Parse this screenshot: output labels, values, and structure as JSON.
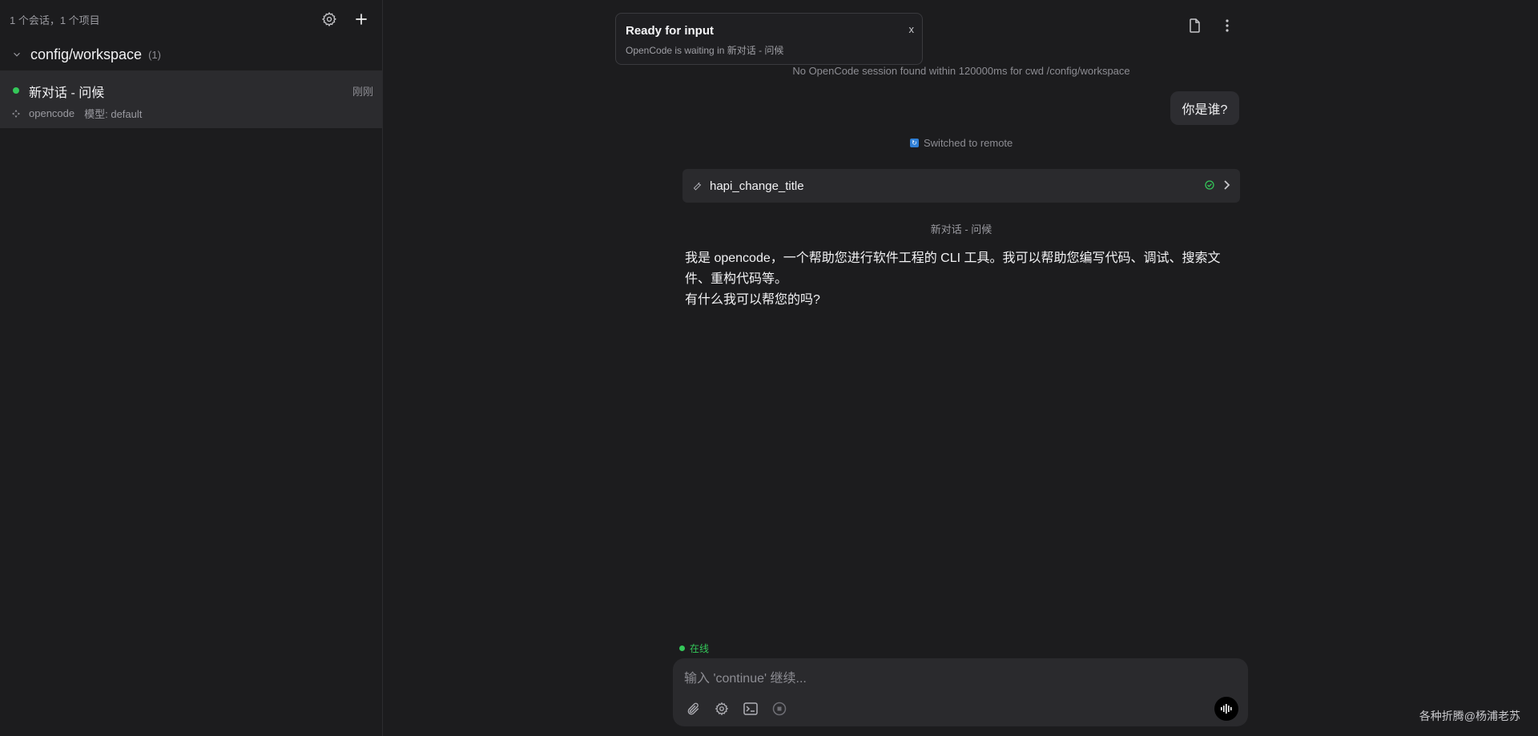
{
  "sidebar": {
    "count_label": "1 个会话，1 个项目",
    "group": {
      "name": "config/workspace",
      "count": "(1)"
    },
    "session": {
      "title": "新对话 - 问候",
      "time": "刚刚",
      "agent": "opencode",
      "model": "模型: default"
    }
  },
  "toast": {
    "title": "Ready for input",
    "subtitle": "OpenCode is waiting in 新对话 - 问候",
    "close": "x"
  },
  "chat": {
    "system_note": "No OpenCode session found within 120000ms for cwd /config/workspace",
    "user_message": "你是谁?",
    "switched_label": "Switched to remote",
    "tool_name": "hapi_change_title",
    "session_title_note": "新对话 - 问候",
    "reply_line1": "我是 opencode，一个帮助您进行软件工程的 CLI 工具。我可以帮助您编写代码、调试、搜索文件、重构代码等。",
    "reply_line2": "有什么我可以帮您的吗?"
  },
  "composer": {
    "status": "在线",
    "placeholder": "输入 'continue' 继续..."
  },
  "watermark": "各种折腾@杨浦老苏",
  "colors": {
    "accent_green": "#34c759",
    "background": "#1c1c1e",
    "panel": "#2a2a2d"
  }
}
